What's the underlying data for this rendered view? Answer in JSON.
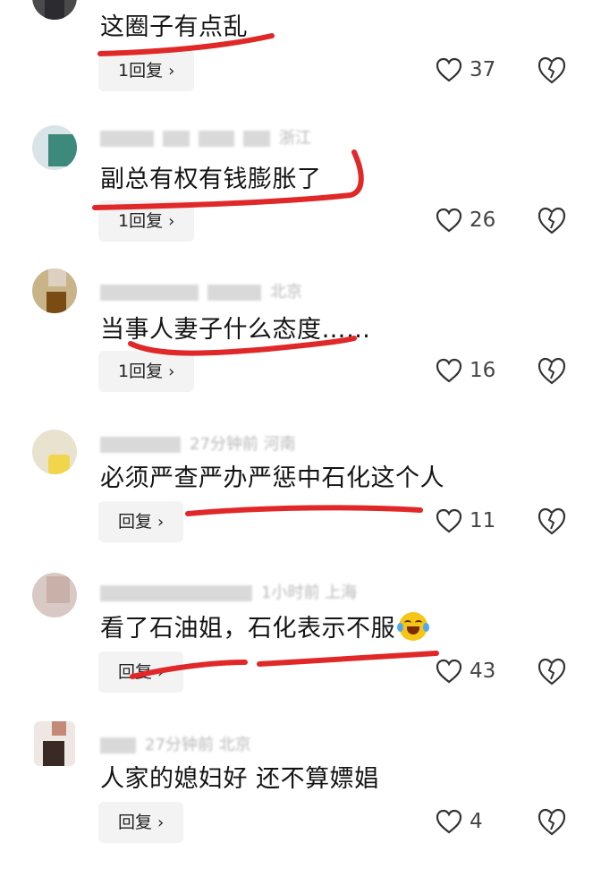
{
  "colors": {
    "annotation_red": "#e02828",
    "reply_bg": "#f3f3f3",
    "count_gray": "#444444"
  },
  "comments": [
    {
      "text": "这圈子有点乱",
      "reply_label": "1回复",
      "likes": "37",
      "meta": ""
    },
    {
      "text": "副总有权有钱膨胀了",
      "reply_label": "1回复",
      "likes": "26",
      "meta": "浙江"
    },
    {
      "text": "当事人妻子什么态度……",
      "reply_label": "1回复",
      "likes": "16",
      "meta": "北京"
    },
    {
      "text": "必须严查严办严惩中石化这个人",
      "reply_label": "回复",
      "likes": "11",
      "meta": "27分钟前 河南"
    },
    {
      "text": "看了石油姐，石化表示不服",
      "reply_label": "回复",
      "likes": "43",
      "meta": "1小时前 上海"
    },
    {
      "text": "人家的媳妇好 还不算嫖娼",
      "reply_label": "回复",
      "likes": "4",
      "meta": "27分钟前 北京"
    }
  ],
  "icons": {
    "like": "heart-outline-icon",
    "dislike": "broken-heart-icon",
    "reply_chevron": "chevron-right-icon"
  }
}
